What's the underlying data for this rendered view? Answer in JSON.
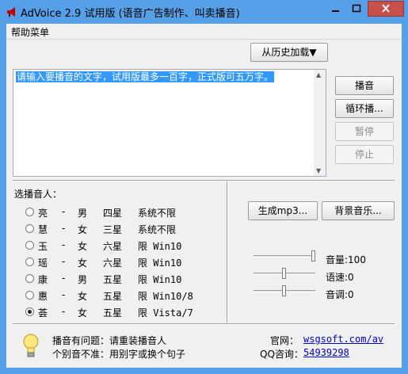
{
  "window": {
    "title": "AdVoice 2.9 试用版 (语音广告制作、叫卖播音)",
    "minimize_icon": "minimize-icon",
    "maximize_icon": "maximize-icon",
    "close_icon": "close-icon"
  },
  "menu": {
    "help": "帮助菜单"
  },
  "history_button": "从历史加载▼",
  "text_input": {
    "value": "请输入要播音的文字，试用版最多一百字，正式版可五万字。"
  },
  "buttons": {
    "play": "播音",
    "loop": "循环播...",
    "pause": "暂停",
    "stop": "停止",
    "mp3": "生成mp3...",
    "bgmusic": "背景音乐..."
  },
  "speakers": {
    "label": "选播音人：",
    "selected_index": 6,
    "items": [
      {
        "name": "亮",
        "dash": "-",
        "gender": "男",
        "stars": "四星",
        "note": "系统不限"
      },
      {
        "name": "慧",
        "dash": "-",
        "gender": "女",
        "stars": "三星",
        "note": "系统不限"
      },
      {
        "name": "玉",
        "dash": "-",
        "gender": "女",
        "stars": "六星",
        "note": "限 Win10"
      },
      {
        "name": "瑶",
        "dash": "-",
        "gender": "女",
        "stars": "六星",
        "note": "限 Win10"
      },
      {
        "name": "康",
        "dash": "-",
        "gender": "男",
        "stars": "五星",
        "note": "限 Win10"
      },
      {
        "name": "惠",
        "dash": "-",
        "gender": "女",
        "stars": "五星",
        "note": "限 Win10/8"
      },
      {
        "name": "荟",
        "dash": "-",
        "gender": "女",
        "stars": "五星",
        "note": "限 Vista/7"
      }
    ]
  },
  "sliders": {
    "volume": {
      "label": "音量:100",
      "value": 100,
      "max": 100
    },
    "speed": {
      "label": "语速:0",
      "value": 0,
      "min": -10,
      "max": 10
    },
    "pitch": {
      "label": "音调:0",
      "value": 0,
      "min": -10,
      "max": 10
    }
  },
  "tips": {
    "line1": "播音有问题：请重装播音人",
    "line2": "个别音不准：用别字或换个句子",
    "icon": "lightbulb-icon"
  },
  "contact": {
    "site_label": "官网：",
    "site": "wsgsoft.com/av",
    "qq_label": "QQ咨询：",
    "qq": "54939298"
  }
}
